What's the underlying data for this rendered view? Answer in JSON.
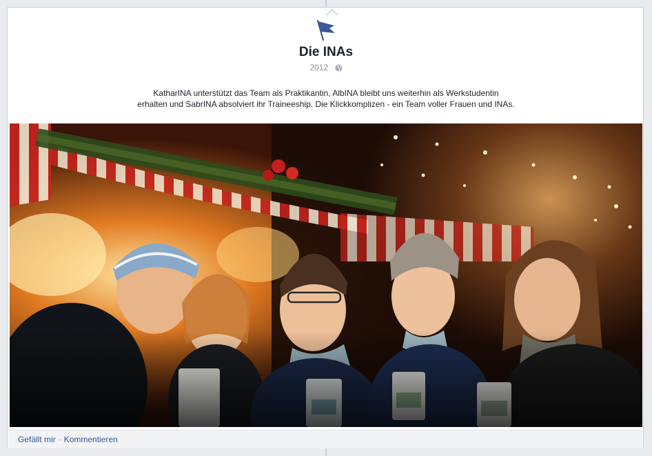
{
  "post": {
    "title": "Die INAs",
    "year": "2012",
    "description_line1": "KatharINA unterstützt das Team als Praktikantin, AlbINA bleibt uns weiterhin als Werkstudentin",
    "description_line2": "erhalten und SabrINA absolviert ihr Traineeship. Die Klickkomplizen - ein Team voller Frauen und INAs.",
    "icons": {
      "header": "flag-icon",
      "privacy": "globe-icon"
    },
    "colors": {
      "flag": "#3b5998",
      "link": "#385898"
    }
  },
  "actions": {
    "like_label": "Gefällt mir",
    "separator": "·",
    "comment_label": "Kommentieren"
  }
}
